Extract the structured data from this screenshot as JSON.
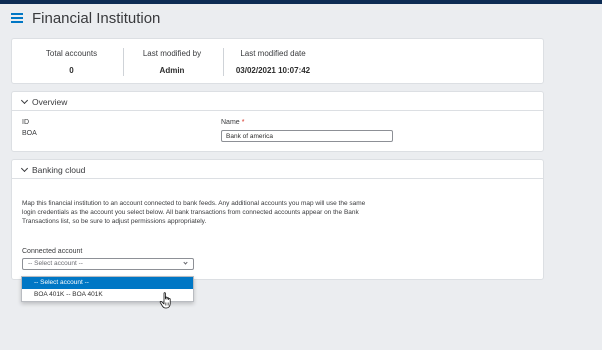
{
  "header": {
    "title": "Financial Institution",
    "menu_icon": "hamburger-list-icon"
  },
  "stats": [
    {
      "label": "Total accounts",
      "value": "0"
    },
    {
      "label": "Last modified by",
      "value": "Admin"
    },
    {
      "label": "Last modified date",
      "value": "03/02/2021 10:07:42"
    }
  ],
  "overview": {
    "heading": "Overview",
    "id_label": "ID",
    "id_value": "BOA",
    "name_label": "Name",
    "required_mark": "*",
    "name_value": "Bank of america"
  },
  "banking": {
    "heading": "Banking cloud",
    "description": "Map this financial institution to an account connected to bank feeds. Any additional accounts you map will use the same login credentials as the account you select below. All bank transactions from connected accounts appear on the Bank Transactions list, so be sure to adjust permissions appropriately.",
    "connected_label": "Connected account",
    "select_placeholder": "-- Select account --",
    "options": [
      "-- Select account --",
      "BOA 401K -- BOA 401K"
    ],
    "selected_option": "-- Select account --"
  },
  "colors": {
    "accent": "#0077c5",
    "top_bar": "#0d2c54",
    "required": "#d52b1e"
  }
}
